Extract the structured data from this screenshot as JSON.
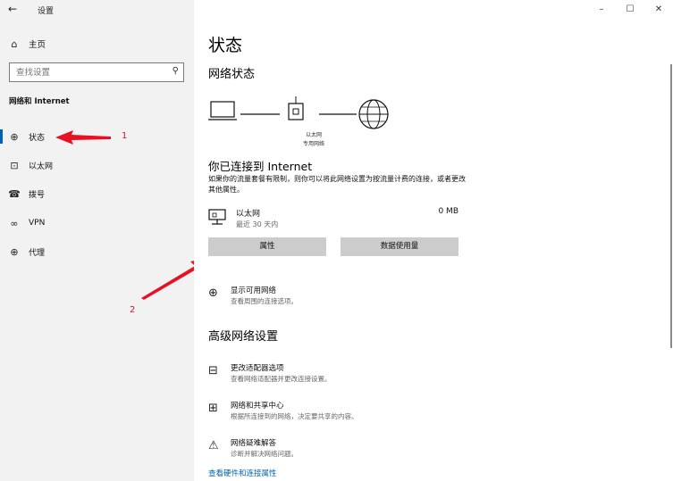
{
  "window": {
    "app_title": "设置",
    "back_icon": "←",
    "controls": {
      "minimize": "–",
      "maximize": "☐",
      "close": "✕"
    }
  },
  "sidebar": {
    "home_label": "主页",
    "search_placeholder": "查找设置",
    "section_label": "网络和 Internet",
    "items": [
      {
        "label": "状态",
        "icon": "status-icon",
        "active": true
      },
      {
        "label": "以太网",
        "icon": "ethernet-icon",
        "active": false
      },
      {
        "label": "拨号",
        "icon": "dialup-icon",
        "active": false
      },
      {
        "label": "VPN",
        "icon": "vpn-icon",
        "active": false
      },
      {
        "label": "代理",
        "icon": "proxy-icon",
        "active": false
      }
    ]
  },
  "annotations": {
    "num1": "1",
    "num2": "2",
    "color": "#e81123"
  },
  "main": {
    "page_title": "状态",
    "network_status_title": "网络状态",
    "diagram_label_1": "以太网",
    "diagram_label_2": "专用网络",
    "connected_title": "你已连接到 Internet",
    "connected_desc": "如果你的流量套餐有限制，则你可以将此网络设置为按流量计费的连接，或者更改其他属性。",
    "adapter": {
      "name": "以太网",
      "sub": "最近 30 天内",
      "usage": "0 MB"
    },
    "buttons": {
      "properties": "属性",
      "data_usage": "数据使用量"
    },
    "show_networks": {
      "title": "显示可用网络",
      "sub": "查看周围的连接选项。"
    },
    "advanced_title": "高级网络设置",
    "advanced_links": [
      {
        "title": "更改适配器选项",
        "sub": "查看网络适配器并更改连接设置。",
        "icon": "adapter-options-icon"
      },
      {
        "title": "网络和共享中心",
        "sub": "根据所连接到的网络，决定要共享的内容。",
        "icon": "sharing-center-icon"
      },
      {
        "title": "网络疑难解答",
        "sub": "诊断并解决网络问题。",
        "icon": "troubleshoot-icon"
      }
    ],
    "hardware_link": "查看硬件和连接属性"
  },
  "colors": {
    "accent": "#0063b1",
    "sidebar_bg": "#f2f2f2",
    "button_bg": "#cccccc"
  }
}
